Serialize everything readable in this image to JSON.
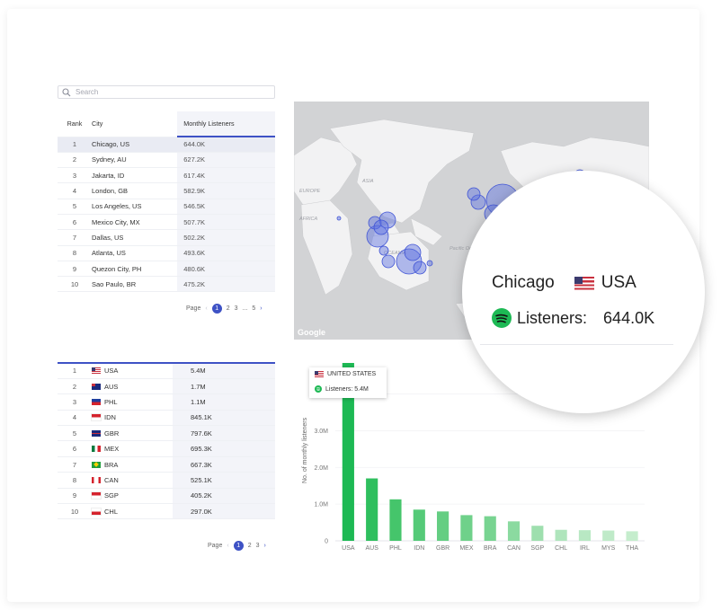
{
  "search": {
    "placeholder": "Search"
  },
  "city_table": {
    "headers": {
      "rank": "Rank",
      "city": "City",
      "listeners": "Monthly Listeners"
    },
    "rows": [
      {
        "rank": "1",
        "city": "Chicago, US",
        "listeners": "644.0K"
      },
      {
        "rank": "2",
        "city": "Sydney, AU",
        "listeners": "627.2K"
      },
      {
        "rank": "3",
        "city": "Jakarta, ID",
        "listeners": "617.4K"
      },
      {
        "rank": "4",
        "city": "London, GB",
        "listeners": "582.9K"
      },
      {
        "rank": "5",
        "city": "Los Angeles, US",
        "listeners": "546.5K"
      },
      {
        "rank": "6",
        "city": "Mexico City, MX",
        "listeners": "507.7K"
      },
      {
        "rank": "7",
        "city": "Dallas, US",
        "listeners": "502.2K"
      },
      {
        "rank": "8",
        "city": "Atlanta, US",
        "listeners": "493.6K"
      },
      {
        "rank": "9",
        "city": "Quezon City, PH",
        "listeners": "480.6K"
      },
      {
        "rank": "10",
        "city": "Sao Paulo, BR",
        "listeners": "475.2K"
      }
    ],
    "pager": {
      "label": "Page",
      "prev": "‹",
      "pages": [
        "1",
        "2",
        "3",
        "...",
        "5"
      ],
      "next": "›"
    }
  },
  "country_table": {
    "rows": [
      {
        "rank": "1",
        "code": "USA",
        "listeners": "5.4M",
        "flag": "us"
      },
      {
        "rank": "2",
        "code": "AUS",
        "listeners": "1.7M",
        "flag": "au"
      },
      {
        "rank": "3",
        "code": "PHL",
        "listeners": "1.1M",
        "flag": "ph"
      },
      {
        "rank": "4",
        "code": "IDN",
        "listeners": "845.1K",
        "flag": "id"
      },
      {
        "rank": "5",
        "code": "GBR",
        "listeners": "797.6K",
        "flag": "gb"
      },
      {
        "rank": "6",
        "code": "MEX",
        "listeners": "695.3K",
        "flag": "mx"
      },
      {
        "rank": "7",
        "code": "BRA",
        "listeners": "667.3K",
        "flag": "br"
      },
      {
        "rank": "8",
        "code": "CAN",
        "listeners": "525.1K",
        "flag": "ca"
      },
      {
        "rank": "9",
        "code": "SGP",
        "listeners": "405.2K",
        "flag": "sg"
      },
      {
        "rank": "10",
        "code": "CHL",
        "listeners": "297.0K",
        "flag": "cl"
      }
    ],
    "pager": {
      "label": "Page",
      "prev": "‹",
      "pages": [
        "1",
        "2",
        "3"
      ],
      "next": "›"
    }
  },
  "map": {
    "labels": [
      "ASIA",
      "EUROPE",
      "AFRICA",
      "OCEANIA",
      "Pacific Ocean"
    ],
    "watermark": "Google"
  },
  "magnifier": {
    "city": "Chicago",
    "country": "USA",
    "listeners_label": "Listeners:",
    "listeners_value": "644.0K"
  },
  "tooltip": {
    "country": "UNITED STATES",
    "listeners": "Listeners: 5.4M"
  },
  "chart_data": {
    "type": "bar",
    "categories": [
      "USA",
      "AUS",
      "PHL",
      "IDN",
      "GBR",
      "MEX",
      "BRA",
      "CAN",
      "SGP",
      "CHL",
      "IRL",
      "MYS",
      "THA"
    ],
    "values": [
      5.4,
      1.7,
      1.13,
      0.85,
      0.8,
      0.7,
      0.67,
      0.53,
      0.41,
      0.3,
      0.29,
      0.28,
      0.26
    ],
    "ylabel": "No. of monthly listeners",
    "yticks": [
      "0",
      "1.0M",
      "2.0M",
      "3.0M",
      "4.0M"
    ],
    "ylim": [
      0,
      4.6
    ],
    "colors": [
      "#1db954",
      "#2fbf5e",
      "#45c56b",
      "#55ca78",
      "#64ce82",
      "#6fd18a",
      "#78d491",
      "#8bdaa0",
      "#9edfae",
      "#afe5bc",
      "#b8e8c3",
      "#bfeac8",
      "#c5edcd"
    ]
  },
  "colors": {
    "accent": "#3e52c5",
    "spotify": "#1db954",
    "bubble": "#5b6ee0"
  }
}
